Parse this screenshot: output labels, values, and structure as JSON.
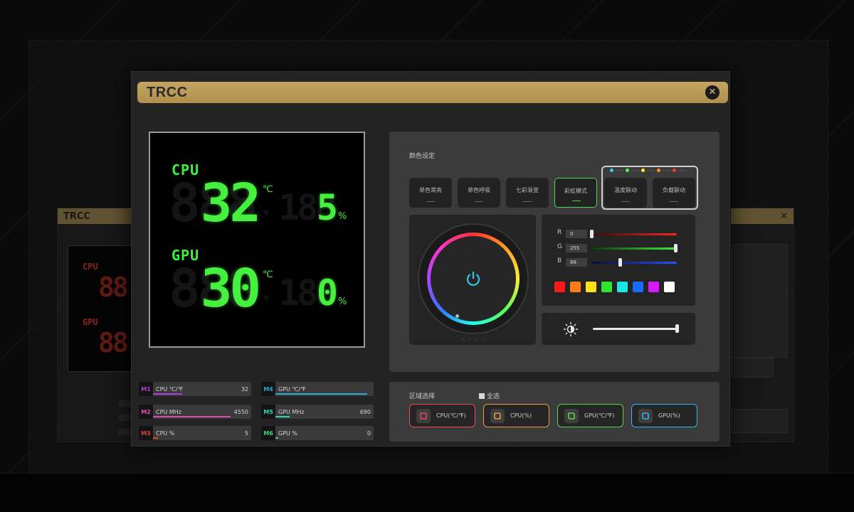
{
  "window": {
    "title": "TRCC",
    "close_glyph": "✕"
  },
  "background_windows": {
    "left_title": "TRCC",
    "left_cpu": "CPU",
    "left_gpu": "GPU"
  },
  "lcd": {
    "cpu": {
      "label": "CPU",
      "temp": "32",
      "temp_unit": "℃",
      "temp_alt_unit": "℉",
      "usage": "5",
      "usage_unit": "%"
    },
    "gpu": {
      "label": "GPU",
      "temp": "30",
      "temp_unit": "℃",
      "temp_alt_unit": "℉",
      "usage": "0",
      "usage_unit": "%"
    },
    "ghost_digits_big": "888",
    "ghost_digits_small": "188"
  },
  "metrics": [
    {
      "tag": "M1",
      "label": "CPU ℃/℉",
      "value": "32",
      "color": "#b43ce0",
      "fill": 0.3
    },
    {
      "tag": "M2",
      "label": "CPU MHz",
      "value": "4550",
      "color": "#e04ab4",
      "fill": 0.8
    },
    {
      "tag": "M3",
      "label": "CPU %",
      "value": "5",
      "color": "#e0443c",
      "fill": 0.05
    },
    {
      "tag": "M4",
      "label": "GPU ℃/℉",
      "value": "",
      "color": "#2ca8d8",
      "fill": 0.95
    },
    {
      "tag": "M5",
      "label": "GPU MHz",
      "value": "690",
      "color": "#2cd8b4",
      "fill": 0.15
    },
    {
      "tag": "M6",
      "label": "GPU %",
      "value": "0",
      "color": "#3cd87c",
      "fill": 0.0
    }
  ],
  "color_settings": {
    "title": "颜色设定",
    "modes": [
      "单色常亮",
      "单色呼吸",
      "七彩渐变",
      "彩虹模式",
      "温度联动",
      "负载联动"
    ],
    "active_mode": "彩虹模式",
    "legend_colors": [
      "#2ad0ff",
      "#44ff44",
      "#ffee33",
      "#ff8a22",
      "#ff3333"
    ]
  },
  "rgb": {
    "r": {
      "label": "R",
      "value": "0",
      "fraction": 0.0
    },
    "g": {
      "label": "G",
      "value": "255",
      "fraction": 1.0
    },
    "b": {
      "label": "B",
      "value": "88",
      "fraction": 0.34
    },
    "swatches": [
      "#ff1a1a",
      "#ff7a1a",
      "#ffe01a",
      "#2ee62e",
      "#1ae6e6",
      "#1a6aff",
      "#d61aff",
      "#ffffff"
    ]
  },
  "brightness": {
    "fraction": 1.0
  },
  "zones": {
    "title": "区域选择",
    "select_all": "全选",
    "buttons": [
      {
        "label": "CPU(℃/℉)",
        "color": "#e84a5a"
      },
      {
        "label": "CPU(%)",
        "color": "#e8a03a"
      },
      {
        "label": "GPU(℃/℉)",
        "color": "#5ad84a"
      },
      {
        "label": "GPU(%)",
        "color": "#3ab4e8"
      }
    ]
  }
}
